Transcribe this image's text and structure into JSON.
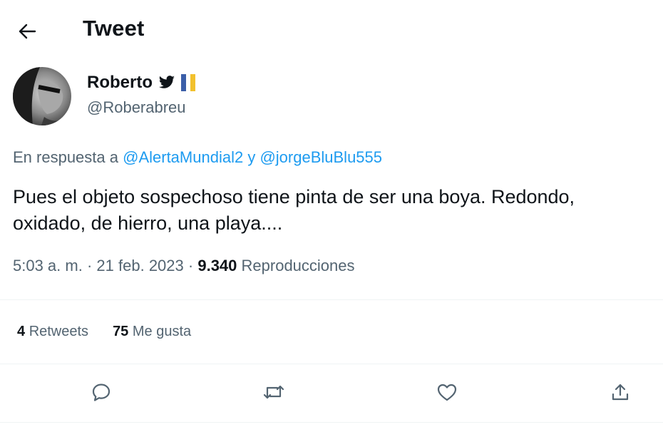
{
  "header": {
    "title": "Tweet",
    "back_icon": "arrow-left-icon"
  },
  "author": {
    "name": "Roberto",
    "handle": "@Roberabreu",
    "badges": [
      "twitter-bird-icon",
      "canary-islands-flag-icon"
    ]
  },
  "reply": {
    "prefix": "En respuesta a",
    "mention1": "@AlertaMundial2",
    "conj": "y",
    "mention2": "@jorgeBluBlu555"
  },
  "tweet": {
    "line1": "Pues el objeto sospechoso tiene pinta de ser una boya. Redondo,",
    "line2": "oxidado, de hierro, una playa...."
  },
  "meta": {
    "time": "5:03 a. m.",
    "sep1": "·",
    "date": "21 feb. 2023",
    "sep2": "·",
    "views_count": "9.340",
    "views_label": "Reproducciones"
  },
  "stats": {
    "retweets_count": "4",
    "retweets_label": "Retweets",
    "likes_count": "75",
    "likes_label": "Me gusta"
  },
  "actions": [
    "reply-icon",
    "retweet-icon",
    "like-icon",
    "share-icon"
  ],
  "colors": {
    "link": "#1d9bf0",
    "muted": "#536471",
    "text": "#0f1419",
    "divider": "#eff3f4"
  }
}
